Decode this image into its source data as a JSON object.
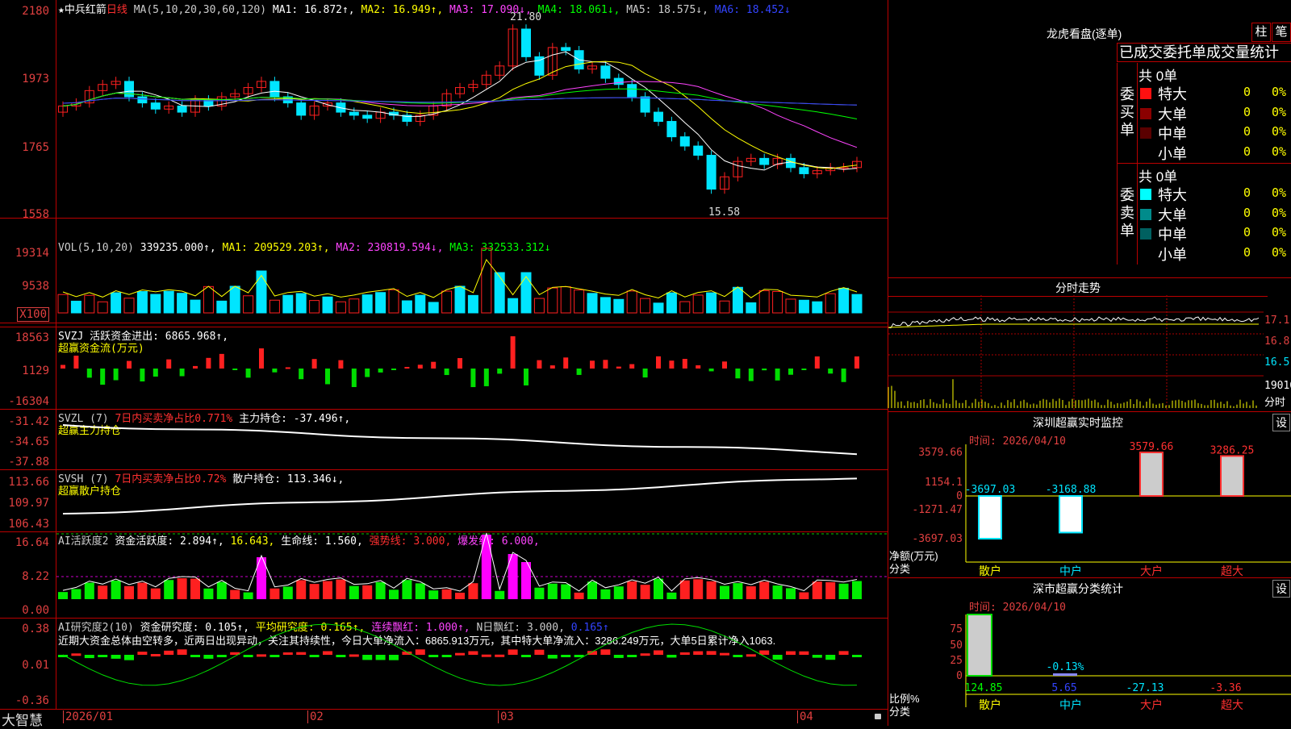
{
  "colors": {
    "up": "#ff2020",
    "down": "#00e5ff",
    "bg": "#000000",
    "grid": "#aa0000",
    "ma1": "#ffffff",
    "ma2": "#ffff00",
    "ma3": "#ff44ff",
    "ma4": "#00ff00",
    "ma5": "#888888",
    "ma6": "#3344ff"
  },
  "header": {
    "star": "★",
    "name": "中兵红箭",
    "period": "日线",
    "ma_params": "MA(5,10,20,30,60,120)",
    "ma1": "MA1: 16.872↑,",
    "ma2": "MA2: 16.949↑,",
    "ma3": "MA3: 17.090↓,",
    "ma4": "MA4: 18.061↓,",
    "ma5": "MA5: 18.575↓,",
    "ma6": "MA6: 18.452↓",
    "high_mark": "21.80",
    "low_mark": "15.58"
  },
  "price_axis": [
    "2180",
    "1973",
    "1765",
    "1558"
  ],
  "vol_panel": {
    "title": "VOL(5,10,20)",
    "value": "339235.000↑,",
    "ma1": "MA1: 209529.203↑,",
    "ma2": "MA2: 230819.594↓,",
    "ma3": "MA3: 332533.312↓",
    "axis": [
      "19314",
      "9538",
      "X100"
    ]
  },
  "svzj_panel": {
    "title": "SVZJ  活跃资金进出: 6865.968↑,",
    "subtitle": "超赢资金流(万元)",
    "axis": [
      "18563",
      "1129",
      "-16304"
    ]
  },
  "svzl_panel": {
    "title_a": "SVZL (7)",
    "title_b": "7日内买卖净占比0.771%",
    "title_c": "主力持仓: -37.496↑,",
    "subtitle": "超赢主力持仓",
    "axis": [
      "-31.42",
      "-34.65",
      "-37.88"
    ]
  },
  "svsh_panel": {
    "title_a": "SVSH (7)",
    "title_b": "7日内买卖净占比0.72%",
    "title_c": "散户持仓: 113.346↓,",
    "subtitle": "超赢散户持仓",
    "axis": [
      "113.66",
      "109.97",
      "106.43"
    ]
  },
  "ai_active_panel": {
    "title_a": "AI活跃度2",
    "title_b": "资金活跃度: 2.894↑,",
    "title_c": "16.643,",
    "title_d": "生命线: 1.560,",
    "title_e": "强势线: 3.000,",
    "title_f": "爆发线: 6.000,",
    "axis": [
      "16.64",
      "8.22",
      "0.00"
    ]
  },
  "ai_research_panel": {
    "title_a": "AI研究度2(10)",
    "title_b": "资金研究度: 0.105↑,",
    "title_c": "平均研究度: 0.165↑,",
    "title_d": "连续飘红: 1.000↑,",
    "title_e": "N日飘红: 3.000,",
    "title_f": "0.165↑",
    "comment": "近期大资金总体由空转多，近两日出现异动，关注其持续性，今日大单净流入：6865.913万元，其中特大单净流入：3286.249万元，大单5日累计净入1063.",
    "axis": [
      "0.38",
      "0.01",
      "-0.36"
    ]
  },
  "time_axis": {
    "brand": "大智慧",
    "labels": [
      "2026/01",
      "02",
      "03",
      "04"
    ]
  },
  "dragon_tiger": {
    "title": "龙虎看盘(逐单)",
    "btn_bar": "柱",
    "btn_pen": "笔",
    "header": "已成交委托单成交量统计",
    "buy_label": "委买单",
    "sell_label": "委卖单",
    "buy_total": "共 0单",
    "sell_total": "共 0单",
    "buy_rows": [
      {
        "name": "特大",
        "count": "0",
        "pct": "0%",
        "color": "#ff1010"
      },
      {
        "name": "大单",
        "count": "0",
        "pct": "0%",
        "color": "#8b0000"
      },
      {
        "name": "中单",
        "count": "0",
        "pct": "0%",
        "color": "#5a0000"
      },
      {
        "name": "小单",
        "count": "0",
        "pct": "0%",
        "color": "#000000"
      }
    ],
    "sell_rows": [
      {
        "name": "特大",
        "count": "0",
        "pct": "0%",
        "color": "#00ffff"
      },
      {
        "name": "大单",
        "count": "0",
        "pct": "0%",
        "color": "#008b8b"
      },
      {
        "name": "中单",
        "count": "0",
        "pct": "0%",
        "color": "#006060"
      },
      {
        "name": "小单",
        "count": "0",
        "pct": "0%",
        "color": "#000000"
      }
    ]
  },
  "intraday": {
    "title": "分时走势",
    "axis": [
      "17.1",
      "16.8",
      "16.5",
      "19016",
      "分时"
    ]
  },
  "sz_monitor": {
    "title": "深圳超赢实时监控",
    "btn": "设",
    "time": "时间: 2026/04/10",
    "axis": [
      "3579.66",
      "1154.1",
      "0",
      "-1271.47",
      "-3697.03"
    ],
    "ylabel1": "净额(万元)",
    "ylabel2": "分类",
    "categories": [
      "散户",
      "中户",
      "大户",
      "超大"
    ],
    "values": [
      -3697.03,
      -3168.88,
      3579.66,
      3286.25
    ],
    "value_labels": [
      "-3697.03",
      "-3168.88",
      "3579.66",
      "3286.25"
    ]
  },
  "sz_class": {
    "title": "深市超赢分类统计",
    "btn": "设",
    "time": "时间: 2026/04/10",
    "axis": [
      "75",
      "50",
      "25",
      "0"
    ],
    "ylabel1": "比例%",
    "ylabel2": "分类",
    "categories": [
      "散户",
      "中户",
      "大户",
      "超大"
    ],
    "bar_label": "-0.13%",
    "bottom_values": [
      "124.85",
      "5.65",
      "-27.13",
      "-3.36"
    ]
  }
}
